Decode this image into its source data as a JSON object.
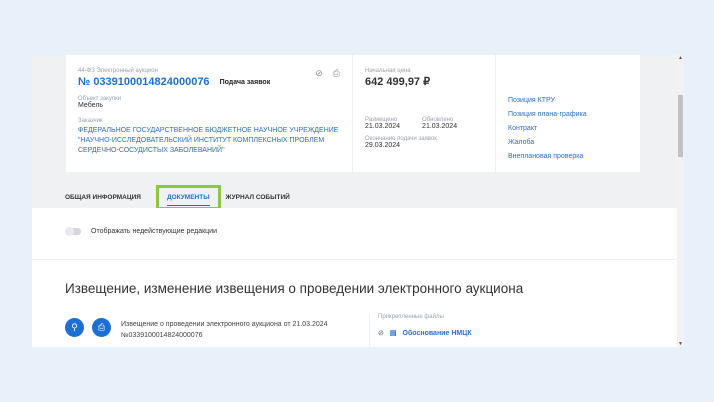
{
  "notice": {
    "law_type": "44-ФЗ Электронный аукцион",
    "number": "№ 0339100014824000076",
    "status": "Подача заявок",
    "object_label": "Объект закупки",
    "object_value": "Мебель",
    "customer_label": "Заказчик",
    "customer_value": "ФЕДЕРАЛЬНОЕ ГОСУДАРСТВЕННОЕ БЮДЖЕТНОЕ НАУЧНОЕ УЧРЕЖДЕНИЕ \"НАУЧНО-ИССЛЕДОВАТЕЛЬСКИЙ ИНСТИТУТ КОМПЛЕКСНЫХ ПРОБЛЕМ СЕРДЕЧНО-СОСУДИСТЫХ ЗАБОЛЕВАНИЙ\"",
    "price_label": "Начальная цена",
    "price_value": "642 499,97 ₽",
    "posted_label": "Размещено",
    "posted_value": "21.03.2024",
    "updated_label": "Обновлено",
    "updated_value": "21.03.2024",
    "deadline_label": "Окончание подачи заявок",
    "deadline_value": "29.03.2024"
  },
  "links": [
    "Позиция КТРУ",
    "Позиция плана-графика",
    "Контракт",
    "Жалоба",
    "Внеплановая проверка"
  ],
  "tabs": [
    "ОБЩАЯ ИНФОРМАЦИЯ",
    "ДОКУМЕНТЫ",
    "ЖУРНАЛ СОБЫТИЙ"
  ],
  "toggle_label": "Отображать недействующие редакции",
  "section_title": "Извещение, изменение извещения о проведении электронного аукциона",
  "document": {
    "line1": "Извещение о проведении электронного аукциона от 21.03.2024",
    "line2": "№0339100014824000076"
  },
  "files": {
    "label": "Прикрепленные файлы",
    "items": [
      "Обоснование НМЦК"
    ]
  }
}
